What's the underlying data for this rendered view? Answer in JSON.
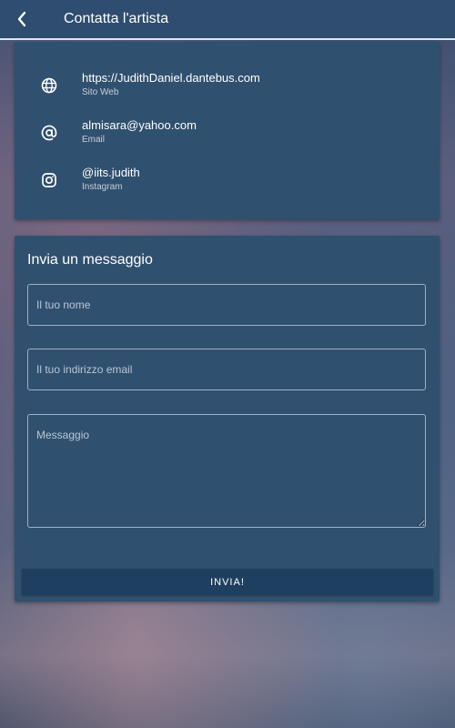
{
  "header": {
    "title": "Contatta l'artista",
    "back_icon": "chevron-left-icon"
  },
  "contacts": [
    {
      "icon": "globe-icon",
      "value": "https://JudithDaniel.dantebus.com",
      "label": "Sito Web"
    },
    {
      "icon": "at-sign-icon",
      "value": "almisara@yahoo.com",
      "label": "Email"
    },
    {
      "icon": "instagram-icon",
      "value": "@iits.judith",
      "label": "Instagram"
    }
  ],
  "message_form": {
    "title": "Invia un messaggio",
    "name_placeholder": "Il tuo nome",
    "email_placeholder": "Il tuo indirizzo email",
    "message_placeholder": "Messaggio",
    "send_label": "INVIA!"
  },
  "colors": {
    "appbar": "#2f4d6e",
    "card": "#30506f",
    "button": "#1f3f60",
    "text": "#ffffff"
  }
}
